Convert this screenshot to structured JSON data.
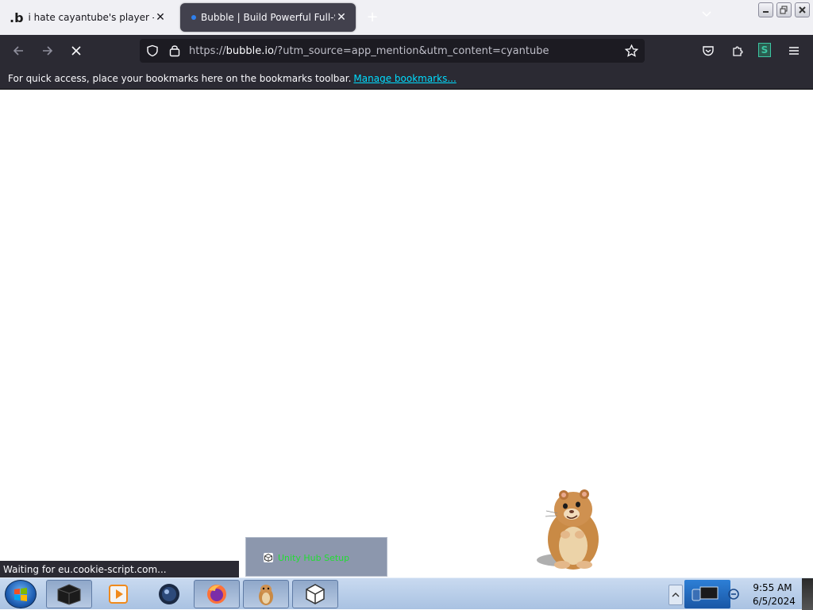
{
  "browser": {
    "tabs": [
      {
        "title": "i hate cayantube's player - Cyan",
        "favicon": "bubble-b-logo",
        "active": false
      },
      {
        "title": "Bubble | Build Powerful Full-Sta",
        "favicon": "loading-dot",
        "active": true
      }
    ],
    "new_tab_symbol": "+",
    "close_symbol": "✕",
    "url": {
      "prefix": "https://",
      "host": "bubble.io",
      "rest": "/?utm_source=app_mention&utm_content=cyantube"
    },
    "extension_badge": "S"
  },
  "bookmarks_bar": {
    "text": "For quick access, place your bookmarks here on the bookmarks toolbar.",
    "link": "Manage bookmarks..."
  },
  "status_bar": {
    "text": "Waiting for eu.cookie-script.com..."
  },
  "unity_popup": {
    "label": "Unity Hub Setup"
  },
  "taskbar": {
    "clock_time": "9:55 AM",
    "clock_date": "6/5/2024"
  },
  "colors": {
    "tab_strip": "#f0f0f4",
    "toolbar": "#2b2a33",
    "urlbar": "#1c1b22",
    "link": "#00ddff",
    "taskbar": "#b7cbe6"
  }
}
